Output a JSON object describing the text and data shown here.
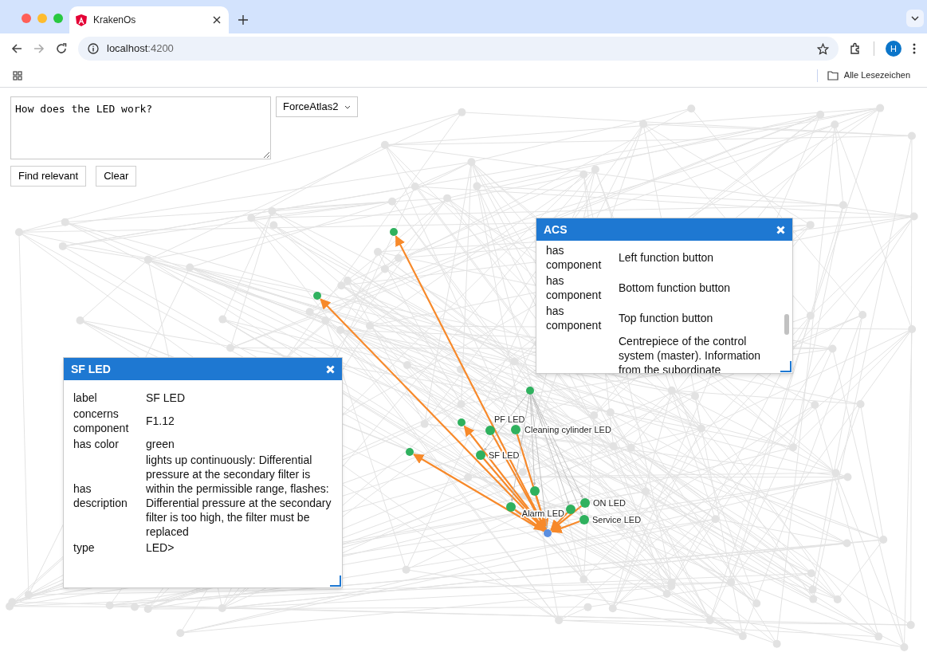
{
  "browser": {
    "tab_title": "KrakenOs",
    "url_host": "localhost",
    "url_port": ":4200",
    "profile_initial": "H",
    "bookmarks_label": "Alle Lesezeichen"
  },
  "query": {
    "value": "How does the LED work?"
  },
  "layout_select": {
    "value": "ForceAtlas2"
  },
  "buttons": [
    "Find relevant",
    "Clear"
  ],
  "graph": {
    "nodes": [
      {
        "kind": "related"
      },
      {
        "kind": "related"
      },
      {
        "kind": "hub"
      },
      {
        "kind": "related"
      },
      {
        "kind": "related",
        "label": "PF LED"
      },
      {
        "kind": "related",
        "label": "Cleaning cylinder LED"
      },
      {
        "kind": "related"
      },
      {
        "kind": "related",
        "label": "SF LED"
      },
      {
        "kind": "related"
      },
      {
        "kind": "related"
      },
      {
        "kind": "related",
        "label": "ON LED"
      },
      {
        "kind": "related",
        "label": "Alarm LED"
      },
      {
        "kind": "related",
        "label": "Service LED"
      },
      {
        "kind": "query"
      }
    ],
    "edges": [
      {
        "kind": "highlight"
      },
      {
        "kind": "highlight"
      },
      {
        "kind": "highlight"
      },
      {
        "kind": "highlight"
      },
      {
        "kind": "highlight"
      },
      {
        "kind": "highlight"
      },
      {
        "kind": "highlight"
      },
      {
        "kind": "highlight"
      },
      {
        "kind": "highlight"
      },
      {
        "kind": "highlight"
      },
      {
        "kind": "highlight"
      },
      {
        "kind": "highlight"
      },
      {
        "kind": "faint"
      },
      {
        "kind": "faint"
      },
      {
        "kind": "faint"
      },
      {
        "kind": "faint"
      },
      {
        "kind": "faint"
      },
      {
        "kind": "faint"
      },
      {
        "kind": "faint"
      }
    ]
  },
  "panels": [
    {
      "title": "ACS",
      "rows": [
        {
          "key": "has component",
          "value": "Left function button"
        },
        {
          "key": "has component",
          "value": "Bottom function button"
        },
        {
          "key": "has component",
          "value": "Top function button"
        },
        {
          "value": "Centrepiece of the control system (master). Information from the subordinate"
        }
      ]
    },
    {
      "title": "SF LED",
      "rows": [
        {
          "key": "label",
          "value": "SF LED"
        },
        {
          "key": "concerns component",
          "value": "F1.12"
        },
        {
          "key": "has color",
          "value": "green"
        },
        {
          "key": "has description",
          "value": "lights up continuously: Differential pressure at the secondary filter is within the permissible range, flashes: Differential pressure at the secondary filter is too high, the filter must be replaced"
        },
        {
          "key": "type",
          "value": "LED>"
        }
      ]
    }
  ]
}
